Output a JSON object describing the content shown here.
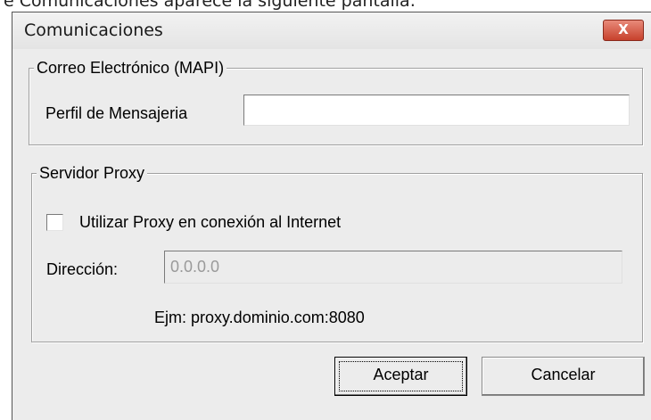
{
  "caption": "e Comunicaciones aparece la siguiente pantalla:",
  "window": {
    "title": "Comunicaciones",
    "close_symbol": "X"
  },
  "mapi_group": {
    "legend": "Correo Electrónico (MAPI)",
    "profile_label": "Perfil de Mensajeria",
    "profile_value": ""
  },
  "proxy_group": {
    "legend": "Servidor Proxy",
    "use_proxy_label": "Utilizar Proxy en conexión al Internet",
    "use_proxy_checked": false,
    "address_label": "Dirección:",
    "address_value": "0.0.0.0",
    "address_enabled": false,
    "example_text": "Ejm: proxy.dominio.com:8080"
  },
  "buttons": {
    "accept_label": "Aceptar",
    "cancel_label": "Cancelar"
  }
}
